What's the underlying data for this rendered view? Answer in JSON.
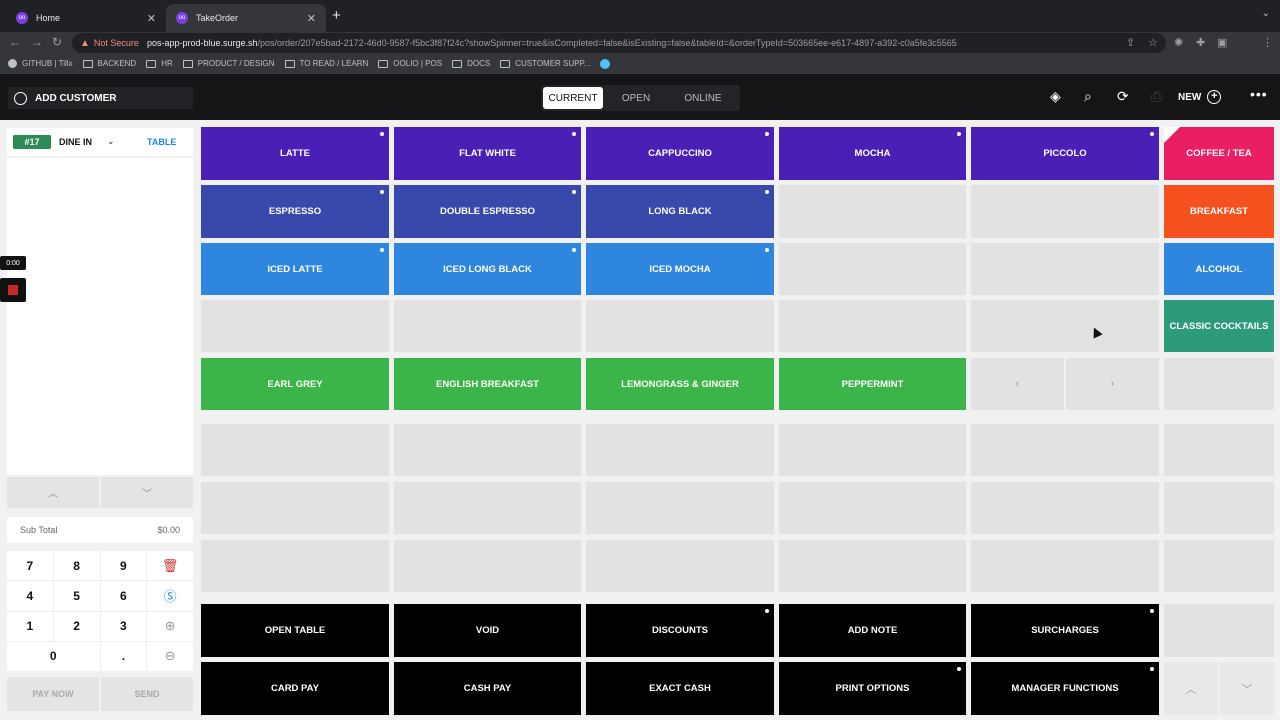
{
  "browser": {
    "tabs": [
      {
        "title": "Home",
        "active": false
      },
      {
        "title": "TakeOrder",
        "active": true
      }
    ],
    "address": {
      "security": "Not Secure",
      "host": "pos-app-prod-blue.surge.sh",
      "path": "/pos/order/207e5bad-2172-46d0-9587-f5bc3f87f24c?showSpinner=true&isCompleted=false&isExisting=false&tableId=&orderTypeId=503665ee-e617-4897-a392-c0a5fe3c5565"
    },
    "bookmarks": [
      "GITHUB | Tillx",
      "BACKEND",
      "HR",
      "PRODUCT / DESIGN",
      "TO READ / LEARN",
      "OOLIO | POS",
      "DOCS",
      "CUSTOMER SUPP..."
    ]
  },
  "header": {
    "add_customer": "ADD CUSTOMER",
    "segments": [
      "CURRENT",
      "OPEN",
      "ONLINE"
    ],
    "new_label": "NEW"
  },
  "order": {
    "number": "#17",
    "type": "DINE IN",
    "table_label": "TABLE",
    "subtotal_label": "Sub Total",
    "subtotal_value": "$0.00",
    "timer": "0:00"
  },
  "keypad": {
    "keys": [
      "7",
      "8",
      "9",
      "4",
      "5",
      "6",
      "1",
      "2",
      "3",
      "0",
      "."
    ]
  },
  "footer_actions": {
    "pay_now": "PAY NOW",
    "send": "SEND"
  },
  "products": {
    "row1": [
      "LATTE",
      "FLAT WHITE",
      "CAPPUCCINO",
      "MOCHA",
      "PICCOLO"
    ],
    "row2": [
      "ESPRESSO",
      "DOUBLE ESPRESSO",
      "LONG BLACK"
    ],
    "row3": [
      "ICED LATTE",
      "ICED LONG BLACK",
      "ICED MOCHA"
    ],
    "row5": [
      "EARL GREY",
      "ENGLISH BREAKFAST",
      "LEMONGRASS & GINGER",
      "PEPPERMINT"
    ]
  },
  "categories": [
    "COFFEE / TEA",
    "BREAKFAST",
    "ALCOHOL",
    "CLASSIC COCKTAILS"
  ],
  "functions": {
    "row1": [
      "OPEN TABLE",
      "VOID",
      "DISCOUNTS",
      "ADD NOTE",
      "SURCHARGES"
    ],
    "row2": [
      "CARD PAY",
      "CASH PAY",
      "EXACT CASH",
      "PRINT OPTIONS",
      "MANAGER FUNCTIONS"
    ]
  },
  "colors": {
    "coffee": "#4a1fb5",
    "espresso": "#3949ab",
    "iced": "#2e86de",
    "tea": "#3bb54a",
    "category_coffee_tea": "#ea1f63",
    "category_breakfast": "#f4511e",
    "category_cocktails": "#2e9a7c",
    "order_badge": "#2e8b57"
  }
}
